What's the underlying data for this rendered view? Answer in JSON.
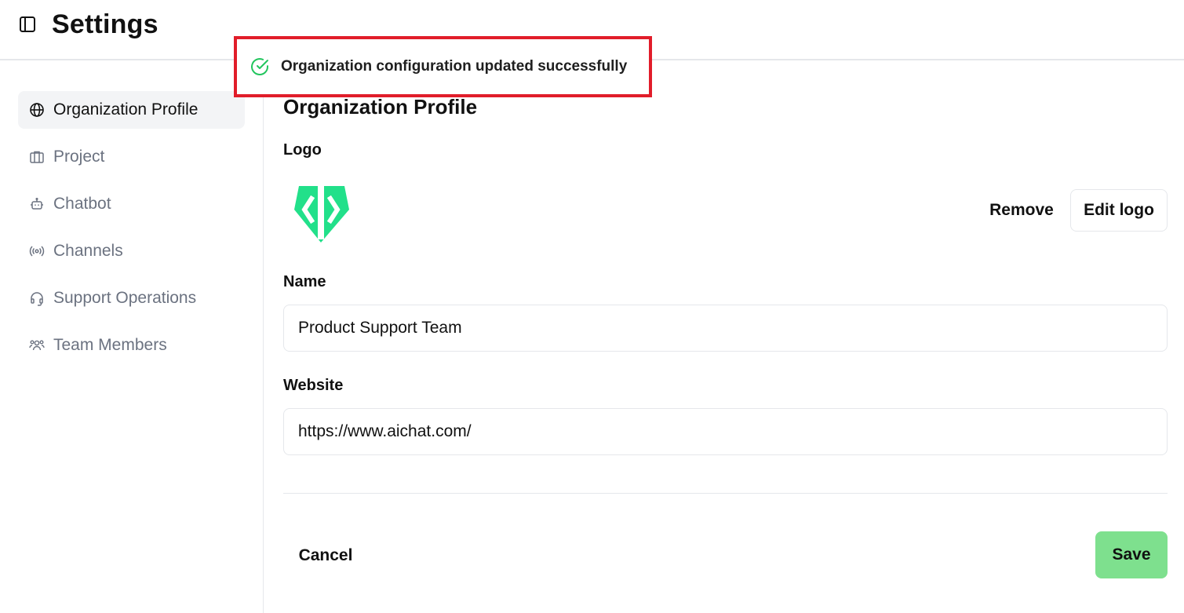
{
  "header": {
    "title": "Settings",
    "toggle_icon": "sidebar-toggle-icon"
  },
  "toast": {
    "message": "Organization configuration updated successfully",
    "icon": "check-circle-icon",
    "color": "#22c55e"
  },
  "sidebar": {
    "items": [
      {
        "label": "Organization Profile",
        "icon": "globe-icon",
        "active": true
      },
      {
        "label": "Project",
        "icon": "briefcase-icon",
        "active": false
      },
      {
        "label": "Chatbot",
        "icon": "bot-icon",
        "active": false
      },
      {
        "label": "Channels",
        "icon": "radio-icon",
        "active": false
      },
      {
        "label": "Support Operations",
        "icon": "headset-icon",
        "active": false
      },
      {
        "label": "Team Members",
        "icon": "users-icon",
        "active": false
      }
    ]
  },
  "main": {
    "section_title": "Organization Profile",
    "logo": {
      "label": "Logo",
      "remove_label": "Remove",
      "edit_label": "Edit logo",
      "brand_color": "#22e08a"
    },
    "name": {
      "label": "Name",
      "value": "Product Support Team"
    },
    "website": {
      "label": "Website",
      "value": "https://www.aichat.com/"
    },
    "cancel_label": "Cancel",
    "save_label": "Save",
    "save_color": "#7ee08e"
  }
}
